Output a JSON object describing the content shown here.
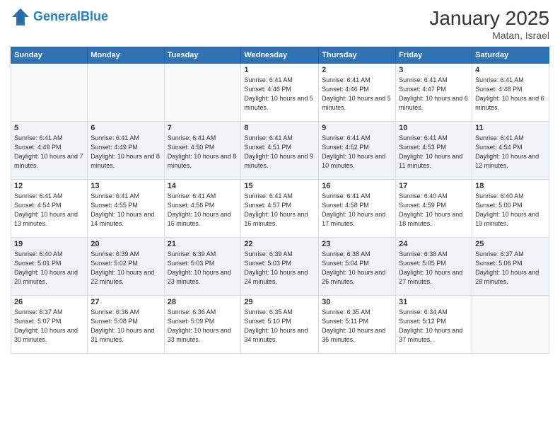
{
  "app": {
    "name": "GeneralBlue",
    "logo_text_part1": "General",
    "logo_text_part2": "Blue"
  },
  "header": {
    "title": "January 2025",
    "location": "Matan, Israel"
  },
  "weekdays": [
    "Sunday",
    "Monday",
    "Tuesday",
    "Wednesday",
    "Thursday",
    "Friday",
    "Saturday"
  ],
  "weeks": [
    [
      {
        "day": "",
        "sunrise": "",
        "sunset": "",
        "daylight": ""
      },
      {
        "day": "",
        "sunrise": "",
        "sunset": "",
        "daylight": ""
      },
      {
        "day": "",
        "sunrise": "",
        "sunset": "",
        "daylight": ""
      },
      {
        "day": "1",
        "sunrise": "Sunrise: 6:41 AM",
        "sunset": "Sunset: 4:46 PM",
        "daylight": "Daylight: 10 hours and 5 minutes."
      },
      {
        "day": "2",
        "sunrise": "Sunrise: 6:41 AM",
        "sunset": "Sunset: 4:46 PM",
        "daylight": "Daylight: 10 hours and 5 minutes."
      },
      {
        "day": "3",
        "sunrise": "Sunrise: 6:41 AM",
        "sunset": "Sunset: 4:47 PM",
        "daylight": "Daylight: 10 hours and 6 minutes."
      },
      {
        "day": "4",
        "sunrise": "Sunrise: 6:41 AM",
        "sunset": "Sunset: 4:48 PM",
        "daylight": "Daylight: 10 hours and 6 minutes."
      }
    ],
    [
      {
        "day": "5",
        "sunrise": "Sunrise: 6:41 AM",
        "sunset": "Sunset: 4:49 PM",
        "daylight": "Daylight: 10 hours and 7 minutes."
      },
      {
        "day": "6",
        "sunrise": "Sunrise: 6:41 AM",
        "sunset": "Sunset: 4:49 PM",
        "daylight": "Daylight: 10 hours and 8 minutes."
      },
      {
        "day": "7",
        "sunrise": "Sunrise: 6:41 AM",
        "sunset": "Sunset: 4:50 PM",
        "daylight": "Daylight: 10 hours and 8 minutes."
      },
      {
        "day": "8",
        "sunrise": "Sunrise: 6:41 AM",
        "sunset": "Sunset: 4:51 PM",
        "daylight": "Daylight: 10 hours and 9 minutes."
      },
      {
        "day": "9",
        "sunrise": "Sunrise: 6:41 AM",
        "sunset": "Sunset: 4:52 PM",
        "daylight": "Daylight: 10 hours and 10 minutes."
      },
      {
        "day": "10",
        "sunrise": "Sunrise: 6:41 AM",
        "sunset": "Sunset: 4:53 PM",
        "daylight": "Daylight: 10 hours and 11 minutes."
      },
      {
        "day": "11",
        "sunrise": "Sunrise: 6:41 AM",
        "sunset": "Sunset: 4:54 PM",
        "daylight": "Daylight: 10 hours and 12 minutes."
      }
    ],
    [
      {
        "day": "12",
        "sunrise": "Sunrise: 6:41 AM",
        "sunset": "Sunset: 4:54 PM",
        "daylight": "Daylight: 10 hours and 13 minutes."
      },
      {
        "day": "13",
        "sunrise": "Sunrise: 6:41 AM",
        "sunset": "Sunset: 4:55 PM",
        "daylight": "Daylight: 10 hours and 14 minutes."
      },
      {
        "day": "14",
        "sunrise": "Sunrise: 6:41 AM",
        "sunset": "Sunset: 4:56 PM",
        "daylight": "Daylight: 10 hours and 15 minutes."
      },
      {
        "day": "15",
        "sunrise": "Sunrise: 6:41 AM",
        "sunset": "Sunset: 4:57 PM",
        "daylight": "Daylight: 10 hours and 16 minutes."
      },
      {
        "day": "16",
        "sunrise": "Sunrise: 6:41 AM",
        "sunset": "Sunset: 4:58 PM",
        "daylight": "Daylight: 10 hours and 17 minutes."
      },
      {
        "day": "17",
        "sunrise": "Sunrise: 6:40 AM",
        "sunset": "Sunset: 4:59 PM",
        "daylight": "Daylight: 10 hours and 18 minutes."
      },
      {
        "day": "18",
        "sunrise": "Sunrise: 6:40 AM",
        "sunset": "Sunset: 5:00 PM",
        "daylight": "Daylight: 10 hours and 19 minutes."
      }
    ],
    [
      {
        "day": "19",
        "sunrise": "Sunrise: 6:40 AM",
        "sunset": "Sunset: 5:01 PM",
        "daylight": "Daylight: 10 hours and 20 minutes."
      },
      {
        "day": "20",
        "sunrise": "Sunrise: 6:39 AM",
        "sunset": "Sunset: 5:02 PM",
        "daylight": "Daylight: 10 hours and 22 minutes."
      },
      {
        "day": "21",
        "sunrise": "Sunrise: 6:39 AM",
        "sunset": "Sunset: 5:03 PM",
        "daylight": "Daylight: 10 hours and 23 minutes."
      },
      {
        "day": "22",
        "sunrise": "Sunrise: 6:39 AM",
        "sunset": "Sunset: 5:03 PM",
        "daylight": "Daylight: 10 hours and 24 minutes."
      },
      {
        "day": "23",
        "sunrise": "Sunrise: 6:38 AM",
        "sunset": "Sunset: 5:04 PM",
        "daylight": "Daylight: 10 hours and 26 minutes."
      },
      {
        "day": "24",
        "sunrise": "Sunrise: 6:38 AM",
        "sunset": "Sunset: 5:05 PM",
        "daylight": "Daylight: 10 hours and 27 minutes."
      },
      {
        "day": "25",
        "sunrise": "Sunrise: 6:37 AM",
        "sunset": "Sunset: 5:06 PM",
        "daylight": "Daylight: 10 hours and 28 minutes."
      }
    ],
    [
      {
        "day": "26",
        "sunrise": "Sunrise: 6:37 AM",
        "sunset": "Sunset: 5:07 PM",
        "daylight": "Daylight: 10 hours and 30 minutes."
      },
      {
        "day": "27",
        "sunrise": "Sunrise: 6:36 AM",
        "sunset": "Sunset: 5:08 PM",
        "daylight": "Daylight: 10 hours and 31 minutes."
      },
      {
        "day": "28",
        "sunrise": "Sunrise: 6:36 AM",
        "sunset": "Sunset: 5:09 PM",
        "daylight": "Daylight: 10 hours and 33 minutes."
      },
      {
        "day": "29",
        "sunrise": "Sunrise: 6:35 AM",
        "sunset": "Sunset: 5:10 PM",
        "daylight": "Daylight: 10 hours and 34 minutes."
      },
      {
        "day": "30",
        "sunrise": "Sunrise: 6:35 AM",
        "sunset": "Sunset: 5:11 PM",
        "daylight": "Daylight: 10 hours and 36 minutes."
      },
      {
        "day": "31",
        "sunrise": "Sunrise: 6:34 AM",
        "sunset": "Sunset: 5:12 PM",
        "daylight": "Daylight: 10 hours and 37 minutes."
      },
      {
        "day": "",
        "sunrise": "",
        "sunset": "",
        "daylight": ""
      }
    ]
  ]
}
